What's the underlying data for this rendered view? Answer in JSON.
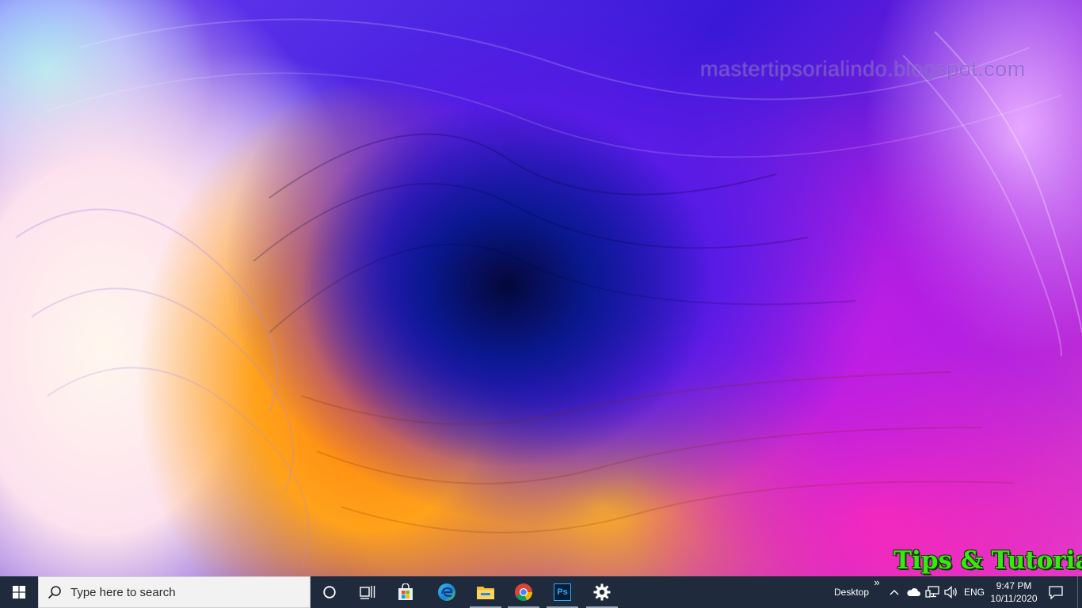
{
  "desktop": {
    "wallpaper": "abstract-swirl-wallpaper",
    "watermark_text": "mastertipsorialindo.blogspot.com",
    "logo_text": "Tips & Tutorial"
  },
  "taskbar": {
    "background": "#1f2a3c",
    "search": {
      "placeholder": "Type here to search"
    },
    "pinned_apps": [
      {
        "name": "cortana-icon"
      },
      {
        "name": "task-view-icon"
      },
      {
        "name": "microsoft-store-icon"
      },
      {
        "name": "edge-icon"
      },
      {
        "name": "file-explorer-icon",
        "running": true
      },
      {
        "name": "chrome-icon",
        "running": true
      },
      {
        "name": "photoshop-icon",
        "label": "Ps",
        "running": true
      },
      {
        "name": "settings-icon",
        "running": true
      }
    ],
    "tray": {
      "desktop_label": "Desktop",
      "toolbar_chevron": "»",
      "language": "ENG",
      "time": "9:47 PM",
      "date": "10/11/2020"
    }
  }
}
